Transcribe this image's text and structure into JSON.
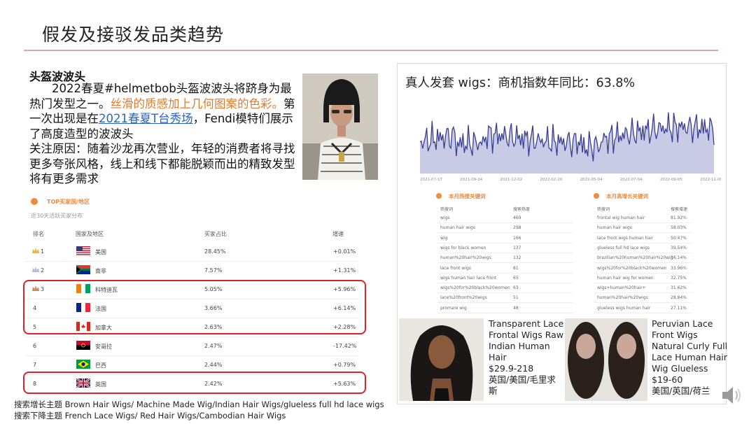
{
  "slide": {
    "title": "假发及接驳发品类趋势"
  },
  "left": {
    "section_title": "头盔波波头",
    "para_part1": "2022春夏#helmetbob头盔波波头将跻身为最热门发型之一。",
    "para_orange": "丝滑的质感加上几何图案的色彩。",
    "para_part2": "第一次出现是在",
    "para_link": "2021春夏T台秀场",
    "para_part3": "，Fendi模特们展示了高度造型的波波头",
    "para_part4": "关注原因：随着沙龙再次营业，年轻的消费者将寻找更多夸张风格，线上和线下都能脱颖而出的精致发型将有更多需求"
  },
  "table": {
    "title": "TOP买家国/地区",
    "subtitle": "近30天活跃买家分布",
    "columns": [
      "排名",
      "国家及地区",
      "买家占比",
      "增速"
    ],
    "rows": [
      {
        "rank": "1",
        "country": "美国",
        "flag": "us-flag",
        "share": "28.45%",
        "growth": "+0.01%"
      },
      {
        "rank": "2",
        "country": "南非",
        "flag": "za-flag",
        "share": "7.57%",
        "growth": "+1.31%"
      },
      {
        "rank": "3",
        "country": "科特迪瓦",
        "flag": "ci-flag",
        "share": "5.05%",
        "growth": "+5.96%"
      },
      {
        "rank": "4",
        "country": "法国",
        "flag": "fr-flag",
        "share": "3.66%",
        "growth": "+6.14%"
      },
      {
        "rank": "5",
        "country": "加拿大",
        "flag": "ca-flag",
        "share": "2.63%",
        "growth": "+2.28%"
      },
      {
        "rank": "6",
        "country": "安哥拉",
        "flag": "ao-flag",
        "share": "2.47%",
        "growth": "-17.42%"
      },
      {
        "rank": "7",
        "country": "巴西",
        "flag": "br-flag",
        "share": "2.44%",
        "growth": "+0.79%"
      },
      {
        "rank": "8",
        "country": "英国",
        "flag": "gb-flag",
        "share": "2.42%",
        "growth": "+5.63%"
      }
    ]
  },
  "footer": {
    "line1": "搜索增长主题 Brown Hair Wigs/ Machine Made Wig/Indian Hair Wigs/glueless full hd lace wigs",
    "line2": "搜索下降主题 French Lace Wigs/ Red Hair Wigs/Cambodian Hair Wigs"
  },
  "right": {
    "title": "真人发套 wigs：商机指数年同比：63.8%",
    "chart_data": {
      "type": "area",
      "x_ticks": [
        "2021-07-17",
        "2021-09-24",
        "2021-12-02",
        "2022-02-20",
        "2022-05-04",
        "2022-07-04",
        "2022-09-05",
        "2022-11-08"
      ],
      "color": "#3b3f93",
      "fill": "#c9cbe6"
    },
    "kw_left": {
      "title": "本月热搜关键词",
      "h1": "热搜词",
      "h2": "搜索热度",
      "rows": [
        [
          "wigs",
          "469"
        ],
        [
          "human hair wigs",
          "298"
        ],
        [
          "wig",
          "166"
        ],
        [
          "wigs for black women",
          "137"
        ],
        [
          "human%20hair%20wigs",
          "132"
        ],
        [
          "lace front wigs",
          "81"
        ],
        [
          "wigs human hair lace front",
          "65"
        ],
        [
          "wigs%20for%20black%20women",
          "63"
        ],
        [
          "lace%20front%20wigs",
          "51"
        ],
        [
          "promare wig",
          "48"
        ]
      ]
    },
    "kw_right": {
      "title": "本月高增长关键词",
      "h1": "热搜词",
      "h2": "搜索增速",
      "rows": [
        [
          "frontal wig human hair",
          "81.92%"
        ],
        [
          "human hair wigs",
          "58.03%"
        ],
        [
          "lace front wigs human hair",
          "50.47%"
        ],
        [
          "glueless full hd lace wigs",
          "39.54%"
        ],
        [
          "brazilian%20human%20hair%20wig",
          "36.14%"
        ],
        [
          "wigs%20for%20black%20women",
          "33.96%"
        ],
        [
          "human hair wig for women",
          "32.75%"
        ],
        [
          "wigs+human%20hair+",
          "31.62%"
        ],
        [
          "human%20hair%20wigs",
          "28.84%"
        ],
        [
          "glueless wigs human hair",
          "27.11%"
        ]
      ]
    },
    "product1": {
      "name_lines": [
        "Transparent Lace",
        "Frontal Wigs Raw",
        "Indian Human",
        "Hair"
      ],
      "price": "$29.9-218",
      "regions_lines": [
        "英国/美国/毛里求",
        "斯"
      ]
    },
    "product2": {
      "name_lines": [
        "Peruvian Lace",
        "Front Wigs",
        "Natural Curly Full",
        "Lace Human Hair",
        "Wig Glueless"
      ],
      "price": " $19-60",
      "regions_lines": [
        "美国/英国/荷兰"
      ]
    }
  }
}
